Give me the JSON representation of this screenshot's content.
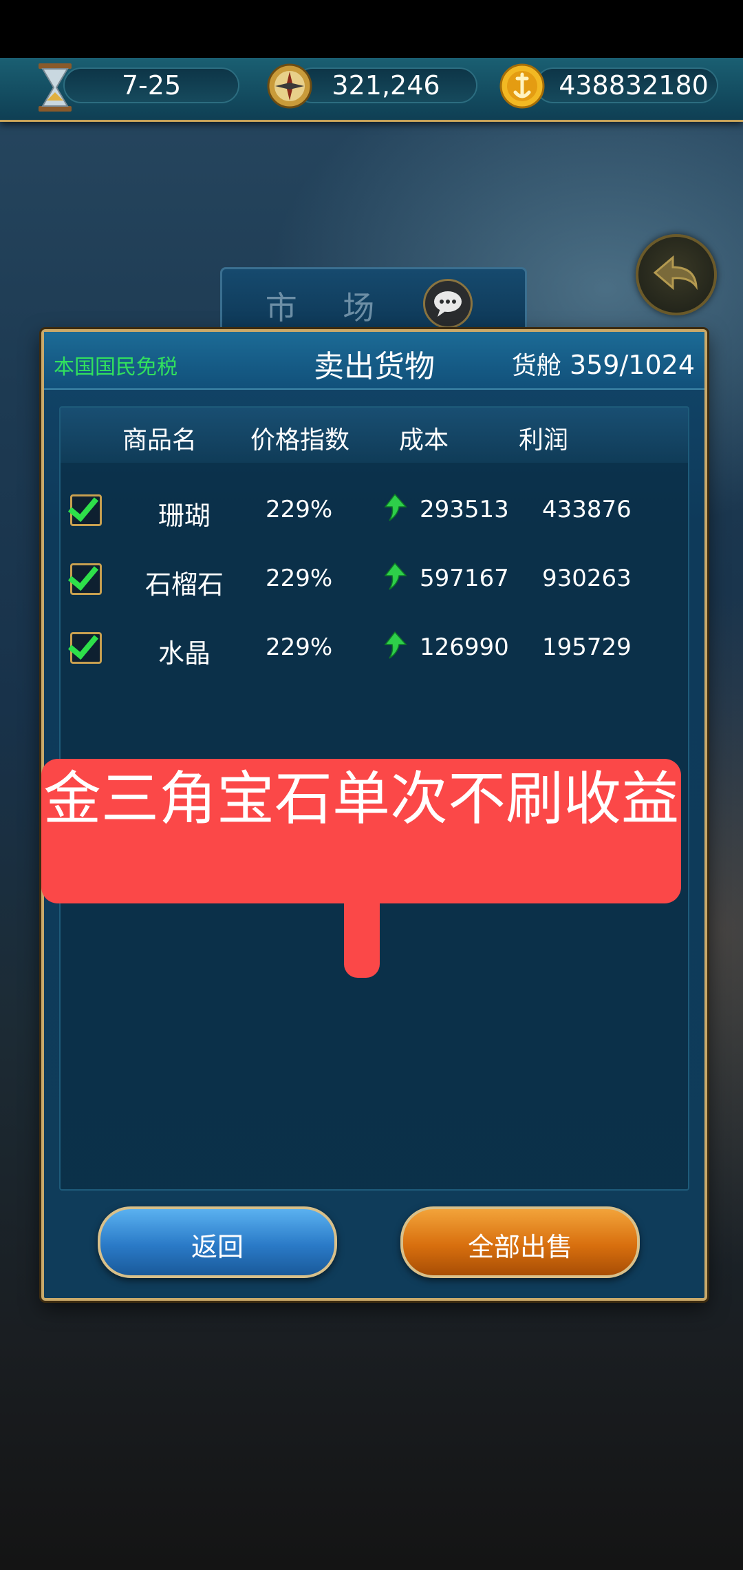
{
  "resources": {
    "date": "7-25",
    "compass_value": "321,246",
    "gold": "438832180"
  },
  "market_title": "市 场",
  "dialog": {
    "tax_note": "本国国民免税",
    "title": "卖出货物",
    "hold_label": "货舱",
    "hold_value": "359/1024",
    "columns": [
      "商品名",
      "价格指数",
      "成本",
      "利润"
    ],
    "rows": [
      {
        "name": "珊瑚",
        "price_index": "229%",
        "cost": "293513",
        "profit": "433876"
      },
      {
        "name": "石榴石",
        "price_index": "229%",
        "cost": "597167",
        "profit": "930263"
      },
      {
        "name": "水晶",
        "price_index": "229%",
        "cost": "126990",
        "profit": "195729"
      }
    ],
    "back_button": "返回",
    "sell_all_button": "全部出售"
  },
  "annotation": {
    "text": "金三角宝石单次不刷收益"
  },
  "colors": {
    "tax_green": "#31e05e",
    "annotation_red": "#fb4848",
    "frame_gold": "#c9a96a"
  },
  "icons": [
    "hourglass-icon",
    "compass-icon",
    "gold-coin-icon",
    "back-arrow-icon",
    "chat-icon",
    "checkbox-checked-icon",
    "price-up-arrow-icon"
  ]
}
